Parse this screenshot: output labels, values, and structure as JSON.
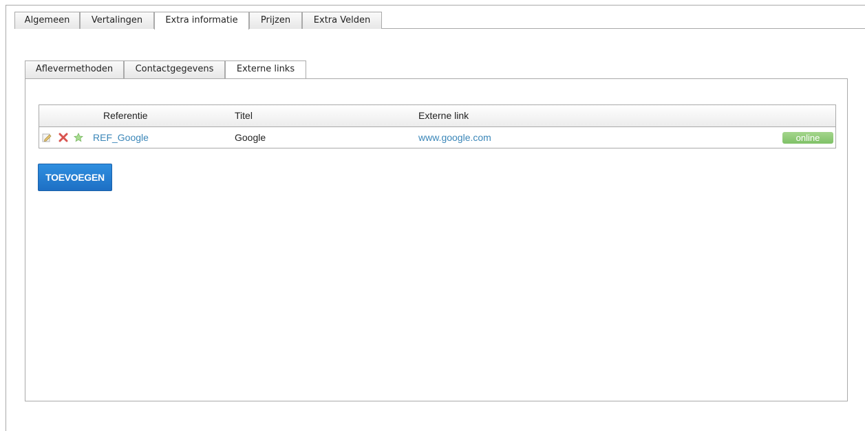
{
  "top_tabs": [
    {
      "label": "Algemeen",
      "active": false
    },
    {
      "label": "Vertalingen",
      "active": false
    },
    {
      "label": "Extra informatie",
      "active": true
    },
    {
      "label": "Prijzen",
      "active": false
    },
    {
      "label": "Extra Velden",
      "active": false
    }
  ],
  "inner_tabs": [
    {
      "label": "Aflevermethoden",
      "active": false
    },
    {
      "label": "Contactgegevens",
      "active": false
    },
    {
      "label": "Externe links",
      "active": true
    }
  ],
  "grid": {
    "columns": [
      "Referentie",
      "Titel",
      "Externe link"
    ],
    "rows": [
      {
        "referentie": "REF_Google",
        "titel": "Google",
        "externe_link": "www.google.com",
        "status": "online",
        "icons": [
          "edit-icon",
          "delete-icon",
          "star-icon"
        ]
      }
    ]
  },
  "add_button_label": "TOEVOEGEN",
  "colors": {
    "link": "#3a86b8",
    "status_online": "#8cc972",
    "primary_button": "#2580d4",
    "delete_icon": "#d9534f",
    "star_icon": "#8fd07a"
  }
}
